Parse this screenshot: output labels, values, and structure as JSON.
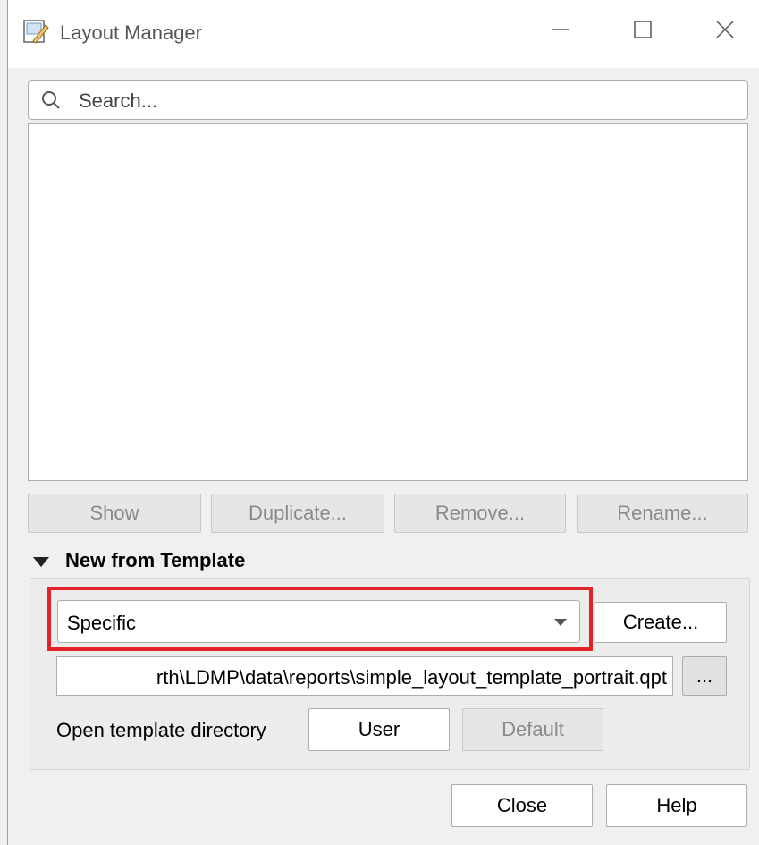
{
  "window": {
    "title": "Layout Manager",
    "minimize_icon": "minimize-icon",
    "maximize_icon": "maximize-icon",
    "close_icon": "close-icon"
  },
  "search": {
    "placeholder": "Search..."
  },
  "actions": {
    "show": "Show",
    "duplicate": "Duplicate...",
    "remove": "Remove...",
    "rename": "Rename..."
  },
  "template_section": {
    "title": "New from Template",
    "template_type": "Specific",
    "create": "Create...",
    "path": "rth\\LDMP\\data\\reports\\simple_layout_template_portrait.qpt",
    "browse": "...",
    "open_dir_label": "Open template directory",
    "user": "User",
    "default": "Default"
  },
  "footer": {
    "close": "Close",
    "help": "Help"
  },
  "colors": {
    "highlight": "#e3242b"
  }
}
